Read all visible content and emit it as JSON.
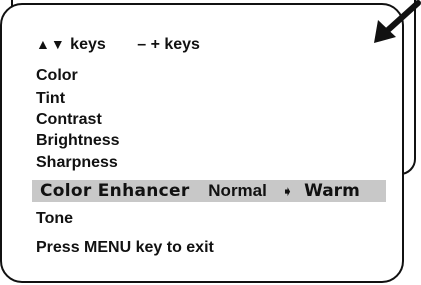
{
  "keys_hint": {
    "arrows": "▲▼",
    "arrows_label": "keys",
    "plusminus": "– + keys"
  },
  "menu": {
    "items": [
      {
        "label": "Color"
      },
      {
        "label": "Tint"
      },
      {
        "label": "Contrast"
      },
      {
        "label": "Brightness"
      },
      {
        "label": "Sharpness"
      }
    ],
    "selected": {
      "label": "Color Enhancer",
      "value": "Normal",
      "pointer": "➧",
      "next_value": "Warm"
    },
    "tone": {
      "label": "Tone"
    },
    "exit_hint": "Press MENU key to exit"
  },
  "icons": {
    "corner_arrow": "arrow-down-left-icon"
  },
  "colors": {
    "highlight": "#c8c8c8",
    "ink": "#111111"
  }
}
